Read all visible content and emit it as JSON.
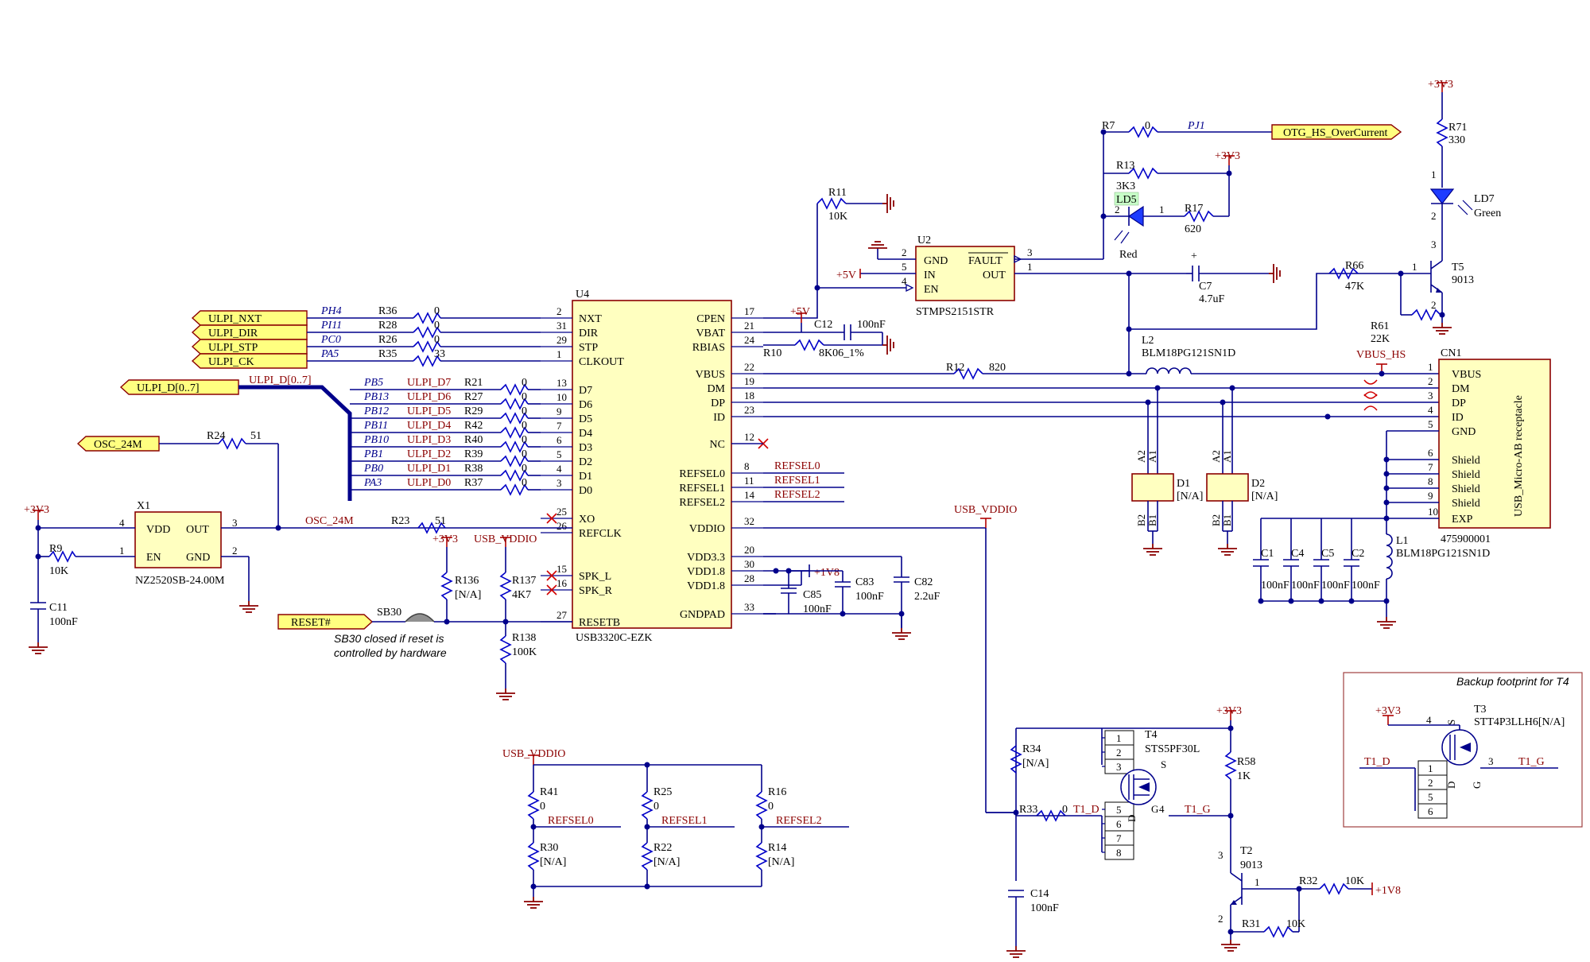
{
  "u4": {
    "ref": "U4",
    "part": "USB3320C-EZK",
    "left_pins": [
      [
        "2",
        "NXT"
      ],
      [
        "31",
        "DIR"
      ],
      [
        "29",
        "STP"
      ],
      [
        "1",
        "CLKOUT"
      ],
      [
        "13",
        "D7"
      ],
      [
        "10",
        "D6"
      ],
      [
        "9",
        "D5"
      ],
      [
        "7",
        "D4"
      ],
      [
        "6",
        "D3"
      ],
      [
        "5",
        "D2"
      ],
      [
        "4",
        "D1"
      ],
      [
        "3",
        "D0"
      ],
      [
        "25",
        "XO"
      ],
      [
        "26",
        "REFCLK"
      ],
      [
        "15",
        "SPK_L"
      ],
      [
        "16",
        "SPK_R"
      ],
      [
        "27",
        "RESETB"
      ]
    ],
    "right_pins": [
      [
        "17",
        "CPEN"
      ],
      [
        "21",
        "VBAT"
      ],
      [
        "24",
        "RBIAS"
      ],
      [
        "22",
        "VBUS"
      ],
      [
        "19",
        "DM"
      ],
      [
        "18",
        "DP"
      ],
      [
        "23",
        "ID"
      ],
      [
        "12",
        "NC"
      ],
      [
        "8",
        "REFSEL0"
      ],
      [
        "11",
        "REFSEL1"
      ],
      [
        "14",
        "REFSEL2"
      ],
      [
        "32",
        "VDDIO"
      ],
      [
        "20",
        "VDD3.3"
      ],
      [
        "30",
        "VDD1.8"
      ],
      [
        "28",
        "VDD1.8"
      ],
      [
        "33",
        "GNDPAD"
      ]
    ]
  },
  "ulpi_ports": [
    "ULPI_NXT",
    "ULPI_DIR",
    "ULPI_STP",
    "ULPI_CK"
  ],
  "ulpi_ctrl": [
    [
      "PH4",
      "R36",
      "0"
    ],
    [
      "PI11",
      "R28",
      "0"
    ],
    [
      "PC0",
      "R26",
      "0"
    ],
    [
      "PA5",
      "R35",
      "33"
    ]
  ],
  "ulpi_data_port": "ULPI_D[0..7]",
  "ulpi_bus_label": "ULPI_D[0..7]",
  "ulpi_data": [
    [
      "PB5",
      "ULPI_D7",
      "R21",
      "0"
    ],
    [
      "PB13",
      "ULPI_D6",
      "R27",
      "0"
    ],
    [
      "PB12",
      "ULPI_D5",
      "R29",
      "0"
    ],
    [
      "PB11",
      "ULPI_D4",
      "R42",
      "0"
    ],
    [
      "PB10",
      "ULPI_D3",
      "R40",
      "0"
    ],
    [
      "PB1",
      "ULPI_D2",
      "R39",
      "0"
    ],
    [
      "PB0",
      "ULPI_D1",
      "R38",
      "0"
    ],
    [
      "PA3",
      "ULPI_D0",
      "R37",
      "0"
    ]
  ],
  "osc_port": "OSC_24M",
  "r24": [
    "R24",
    "51"
  ],
  "x1": {
    "ref": "X1",
    "part": "NZ2520SB-24.00M",
    "vdd": "VDD",
    "en": "EN",
    "out": "OUT",
    "gnd": "GND",
    "p4": "4",
    "p1": "1",
    "p3": "3",
    "p2": "2"
  },
  "pwr_3v3": "+3V3",
  "r9": [
    "R9",
    "10K"
  ],
  "c11": [
    "C11",
    "100nF"
  ],
  "osc_net": "OSC_24M",
  "r23": [
    "R23",
    "51"
  ],
  "reset_port": "RESET#",
  "sb30": "SB30",
  "sb30_note": [
    "SB30 closed if reset is",
    "controlled by hardware"
  ],
  "r136": [
    "R136",
    "[N/A]"
  ],
  "r137": [
    "R137",
    "4K7"
  ],
  "r138": [
    "R138",
    "100K"
  ],
  "usb_vddio": "USB_VDDIO",
  "u2": {
    "ref": "U2",
    "part": "STMPS2151STR",
    "gnd": "GND",
    "in": "IN",
    "en": "EN",
    "fault": "FAULT",
    "out": "OUT",
    "p2": "2",
    "p5": "5",
    "p4": "4",
    "p3": "3",
    "p1": "1"
  },
  "pwr_5v": "+5V",
  "r11": [
    "R11",
    "10K"
  ],
  "c12": [
    "C12",
    "100nF"
  ],
  "r10": [
    "R10",
    "8K06_1%"
  ],
  "r7": [
    "R7",
    "0"
  ],
  "pj1": "PJ1",
  "otg_port": "OTG_HS_OverCurrent",
  "r13": [
    "R13",
    "3K3"
  ],
  "ld5": [
    "LD5",
    "Red"
  ],
  "r17": [
    "R17",
    "620"
  ],
  "c7": [
    "C7",
    "4.7uF"
  ],
  "r12": [
    "R12",
    "820"
  ],
  "l2": [
    "L2",
    "BLM18PG121SN1D"
  ],
  "vbus_hs": "VBUS_HS",
  "cn1": {
    "ref": "CN1",
    "part": "475900001",
    "title": "USB_Micro-AB receptacle",
    "pins": [
      [
        "1",
        "VBUS"
      ],
      [
        "2",
        "DM"
      ],
      [
        "3",
        "DP"
      ],
      [
        "4",
        "ID"
      ],
      [
        "5",
        "GND"
      ],
      [
        "6",
        "Shield"
      ],
      [
        "7",
        "Shield"
      ],
      [
        "8",
        "Shield"
      ],
      [
        "9",
        "Shield"
      ],
      [
        "10",
        "EXP"
      ]
    ]
  },
  "d1": [
    "D1",
    "[N/A]"
  ],
  "d2": [
    "D2",
    "[N/A]"
  ],
  "diode_pins": [
    "A2",
    "A1",
    "B2",
    "B1"
  ],
  "caps_cn": [
    [
      "C1",
      "100nF"
    ],
    [
      "C4",
      "100nF"
    ],
    [
      "C5",
      "100nF"
    ],
    [
      "C2",
      "100nF"
    ]
  ],
  "l1": [
    "L1",
    "BLM18PG121SN1D"
  ],
  "r71": [
    "R71",
    "330"
  ],
  "ld7": [
    "LD7",
    "Green"
  ],
  "t5": [
    "T5",
    "9013"
  ],
  "r66": [
    "R66",
    "47K"
  ],
  "r61": [
    "R61",
    "22K"
  ],
  "pwr_1v8": "+1V8",
  "c85": [
    "C85",
    "100nF"
  ],
  "c83": [
    "C83",
    "100nF"
  ],
  "c82": [
    "C82",
    "2.2uF"
  ],
  "refsel": [
    "REFSEL0",
    "REFSEL1",
    "REFSEL2"
  ],
  "r_top": [
    [
      "R41",
      "0"
    ],
    [
      "R25",
      "0"
    ],
    [
      "R16",
      "0"
    ]
  ],
  "r_bot": [
    [
      "R30",
      "[N/A]"
    ],
    [
      "R22",
      "[N/A]"
    ],
    [
      "R14",
      "[N/A]"
    ]
  ],
  "r34": [
    "R34",
    "[N/A]"
  ],
  "r33": [
    "R33",
    "0"
  ],
  "t1_d": "T1_D",
  "t1_g": "T1_G",
  "c14": [
    "C14",
    "100nF"
  ],
  "t4": [
    "T4",
    "STS5PF30L"
  ],
  "t4_pins": [
    "1",
    "2",
    "3",
    "5",
    "6",
    "7",
    "8",
    "4"
  ],
  "r58": [
    "R58",
    "1K"
  ],
  "t2": [
    "T2",
    "9013"
  ],
  "r32": [
    "R32",
    "10K"
  ],
  "r31": [
    "R31",
    "10K"
  ],
  "backup_title": "Backup footprint for T4",
  "t3": [
    "T3",
    "STT4P3LLH6[N/A]"
  ],
  "t3_pins": [
    "4",
    "1",
    "2",
    "5",
    "6",
    "3"
  ],
  "fet_letters": [
    "S",
    "D",
    "G"
  ]
}
